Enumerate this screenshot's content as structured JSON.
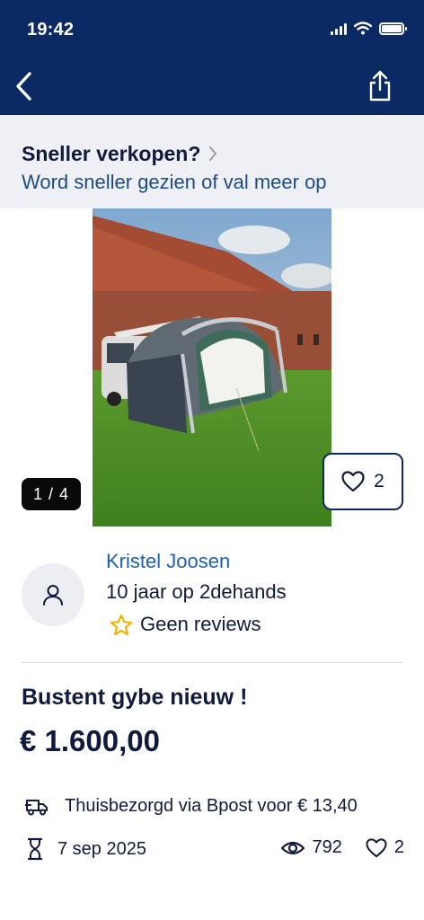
{
  "status_bar": {
    "time": "19:42"
  },
  "promo": {
    "title": "Sneller verkopen?",
    "subtitle": "Word sneller gezien of val meer op"
  },
  "gallery": {
    "counter": "1 / 4",
    "favorites_count": "2"
  },
  "seller": {
    "name": "Kristel Joosen",
    "member_since": "10 jaar op 2dehands",
    "reviews": "Geen reviews"
  },
  "listing": {
    "title": "Bustent gybe nieuw !",
    "price": "€ 1.600,00",
    "delivery": "Thuisbezorgd via Bpost voor € 13,40",
    "date": "7 sep 2025",
    "views": "792",
    "favorites": "2"
  },
  "icons": {
    "back": "chevron-left-icon",
    "share": "share-icon",
    "promo_chevron": "chevron-right-icon",
    "favorite": "heart-icon",
    "avatar": "user-icon",
    "reviews": "star-icon",
    "delivery": "delivery-truck-icon",
    "date": "hourglass-icon",
    "views": "eye-icon"
  },
  "colors": {
    "header": "#0b2a63",
    "promo_bg": "#eef0f5",
    "link": "#1d61b0",
    "star": "#f0b400",
    "text": "#0f1a3c"
  }
}
